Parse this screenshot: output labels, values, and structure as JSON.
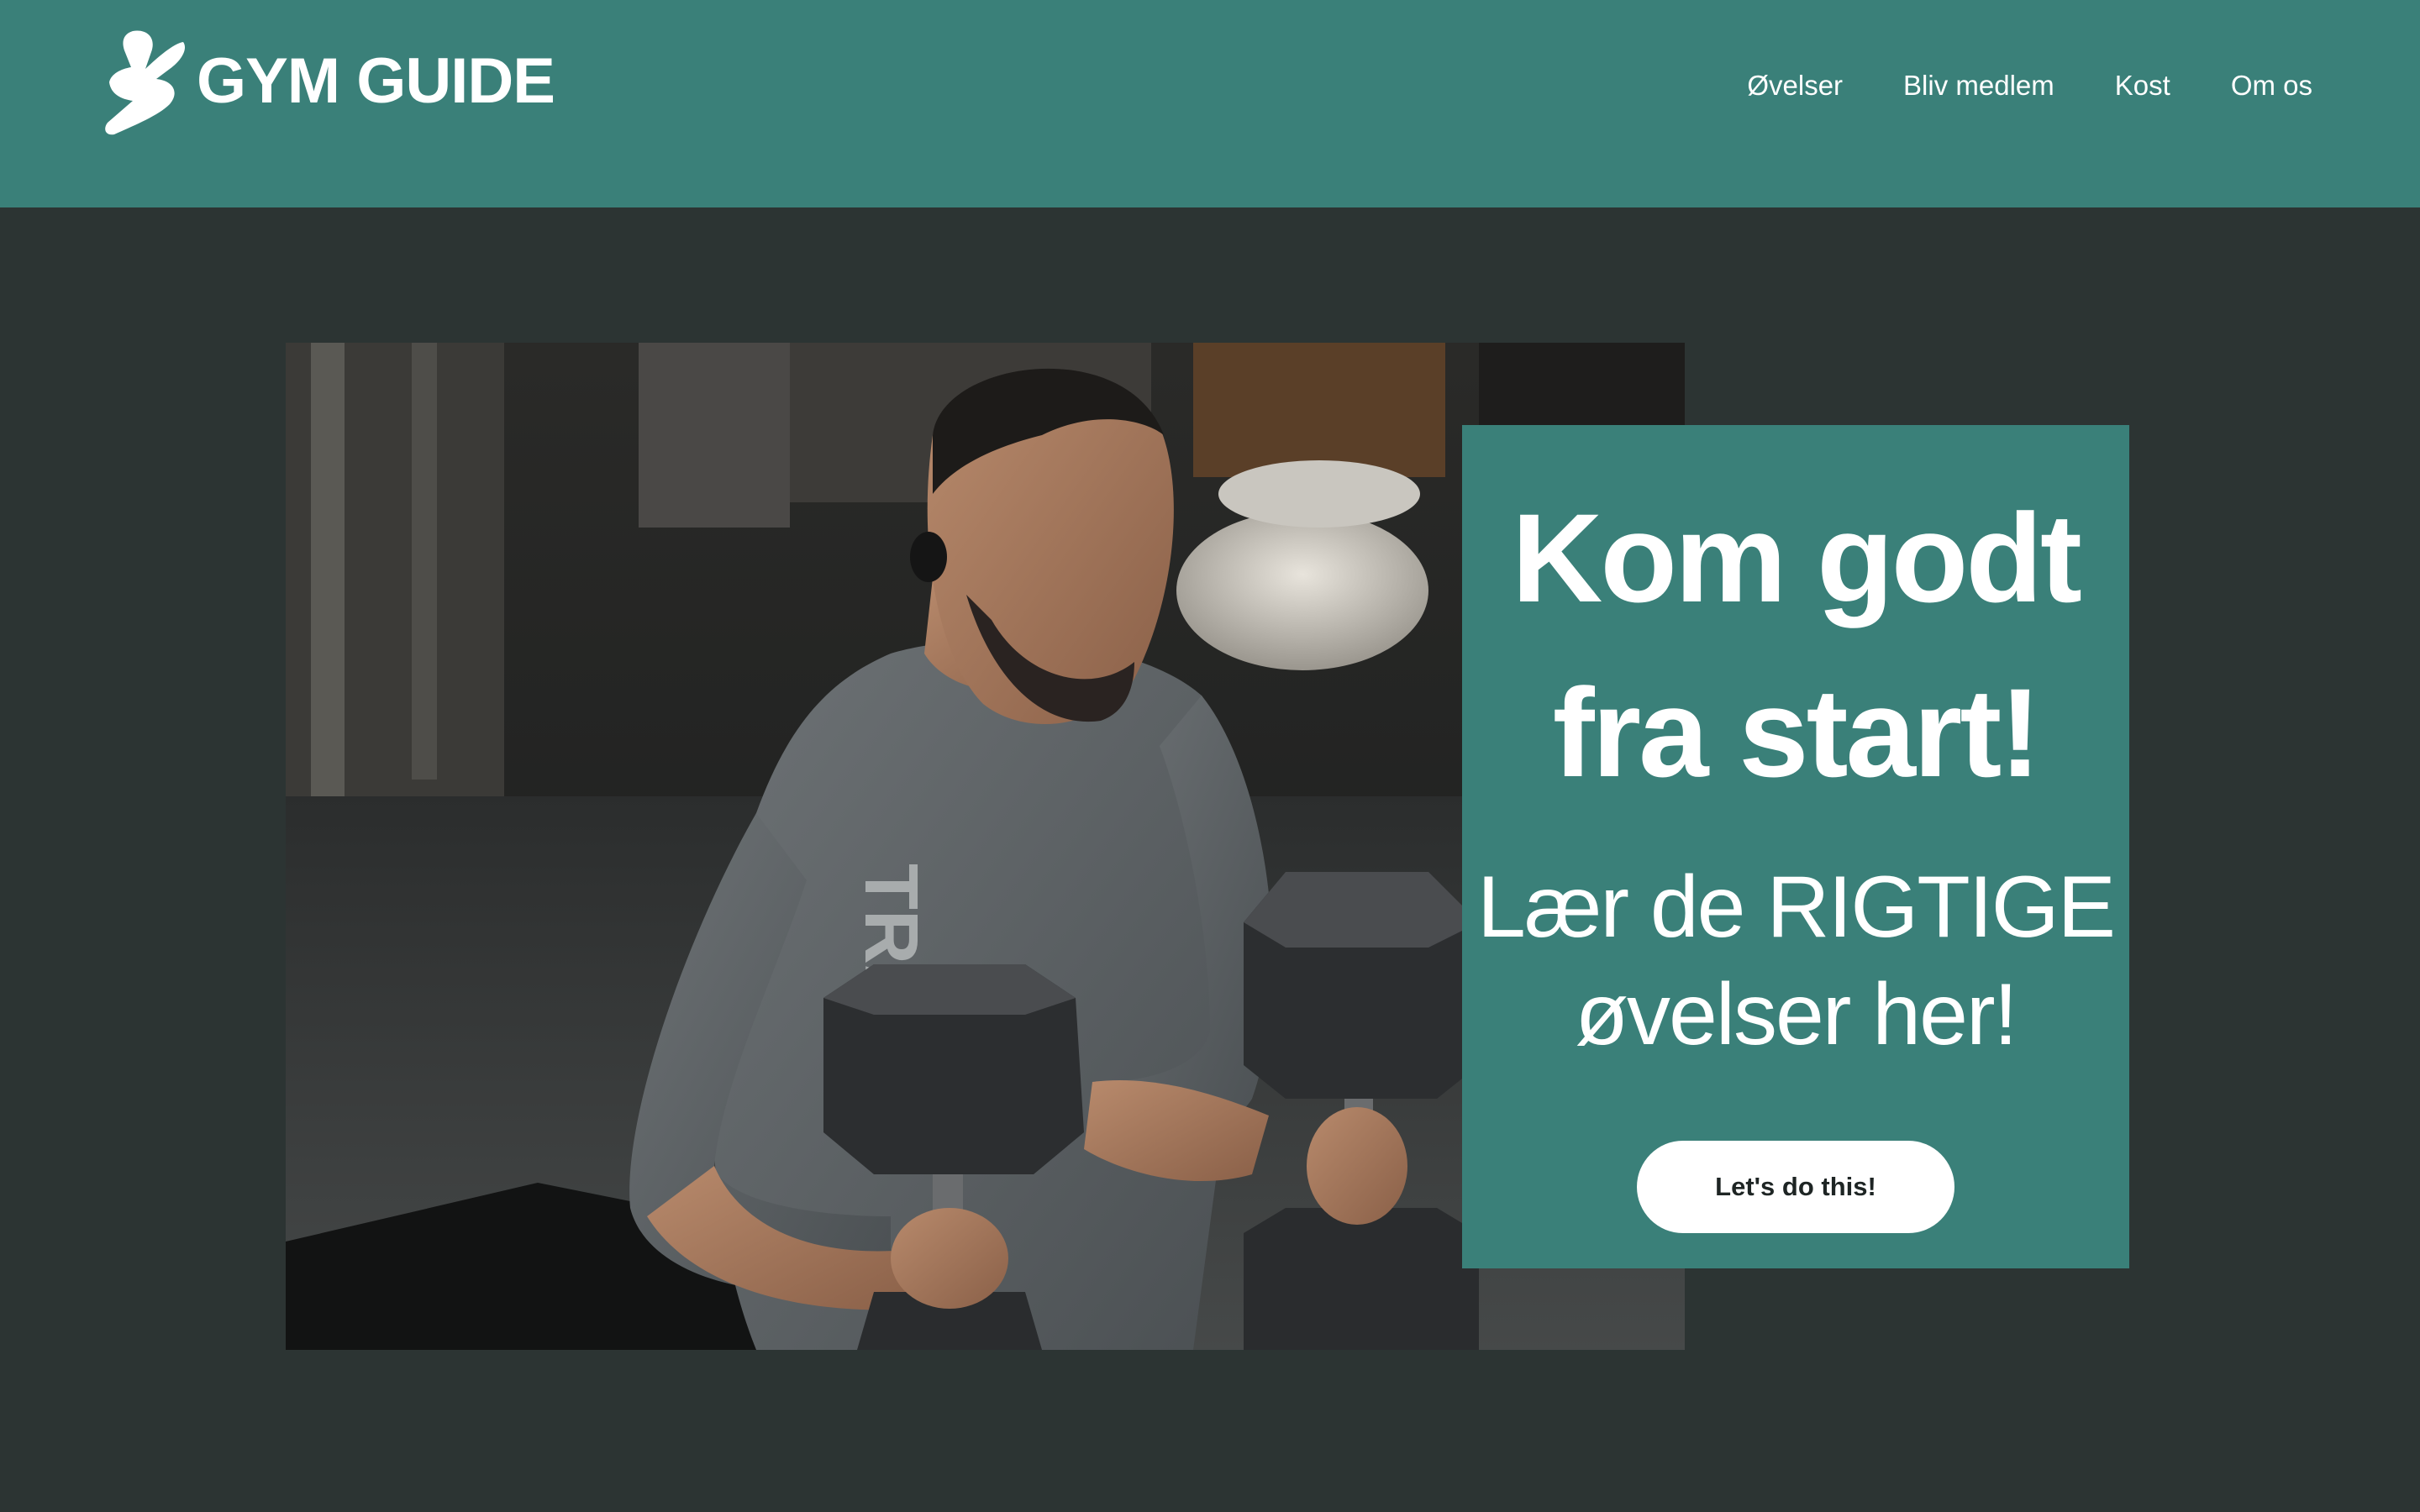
{
  "brand": {
    "name": "GYM GUIDE",
    "logo_icon": "running-figure-icon"
  },
  "nav": {
    "items": [
      {
        "label": "Øvelser"
      },
      {
        "label": "Bliv medlem"
      },
      {
        "label": "Kost"
      },
      {
        "label": "Om os"
      }
    ]
  },
  "hero": {
    "image_description": "man-lifting-dumbbells-photo",
    "title": "Kom godt\nfra start!",
    "subtitle": "Lær de RIGTIGE\nøvelser her!",
    "cta_label": "Let's do this!"
  },
  "colors": {
    "header_bg": "#3a8079",
    "page_bg": "#2c3433",
    "accent": "#3a8079",
    "button_bg": "#ffffff",
    "button_text": "#1e2524"
  }
}
